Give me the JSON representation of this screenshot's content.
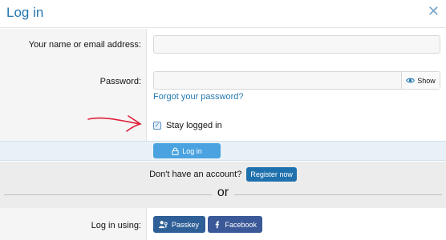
{
  "dialog": {
    "title": "Log in",
    "close_glyph": "✕"
  },
  "form": {
    "username_label": "Your name or email address:",
    "username_value": "",
    "password_label": "Password:",
    "password_value": "",
    "show_label": "Show",
    "forgot_link": "Forgot your password?",
    "stay_logged_in_label": "Stay logged in",
    "stay_logged_in_checked": true,
    "submit_label": "Log in"
  },
  "register": {
    "prompt": "Don't have an account?",
    "button_label": "Register now"
  },
  "divider_text": "or",
  "social": {
    "label": "Log in using:",
    "passkey_label": "Passkey",
    "facebook_label": "Facebook"
  },
  "colors": {
    "accent": "#2577b1",
    "annotation_arrow": "#e0203a"
  },
  "icons": [
    "close-icon",
    "eye-icon",
    "checkbox-checked-icon",
    "lock-icon",
    "passkey-icon",
    "facebook-icon",
    "hand-drawn-arrow"
  ]
}
